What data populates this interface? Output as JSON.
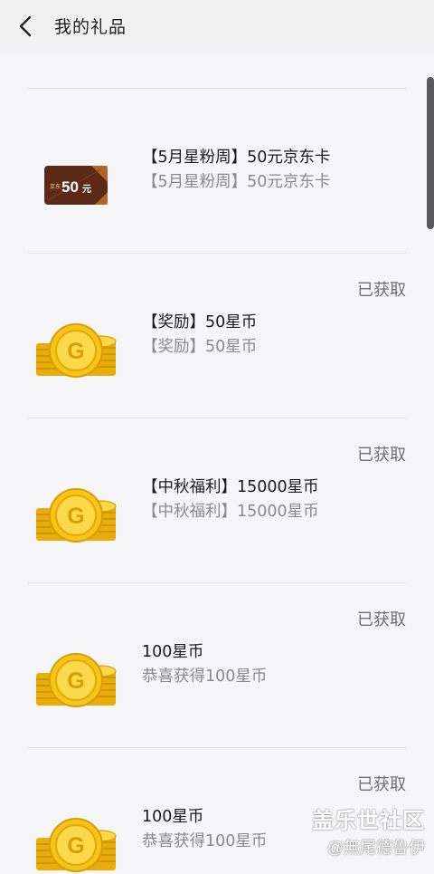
{
  "header": {
    "title": "我的礼品",
    "back_icon": "chevron-left-icon"
  },
  "card": {
    "amount": "50",
    "unit": "元",
    "tag": "京东"
  },
  "gifts": [
    {
      "status": "",
      "title": "【5月星粉周】50元京东卡",
      "subtitle": "【5月星粉周】50元京东卡",
      "thumb": "jd-gift-card"
    },
    {
      "status": "已获取",
      "title": "【奖励】50星币",
      "subtitle": "【奖励】50星币",
      "thumb": "coin-stack-icon"
    },
    {
      "status": "已获取",
      "title": "【中秋福利】15000星币",
      "subtitle": "【中秋福利】15000星币",
      "thumb": "coin-stack-icon"
    },
    {
      "status": "已获取",
      "title": "100星币",
      "subtitle": "恭喜获得100星币",
      "thumb": "coin-stack-icon"
    },
    {
      "status": "已获取",
      "title": "100星币",
      "subtitle": "恭喜获得100星币",
      "thumb": "coin-stack-icon"
    }
  ],
  "watermark": {
    "line1": "盖乐世社区",
    "line2": "@無尾德鲁伊"
  },
  "colors": {
    "coin_gold": "#f5c518",
    "card_brown": "#5a2a16",
    "status_gray": "#707070"
  }
}
